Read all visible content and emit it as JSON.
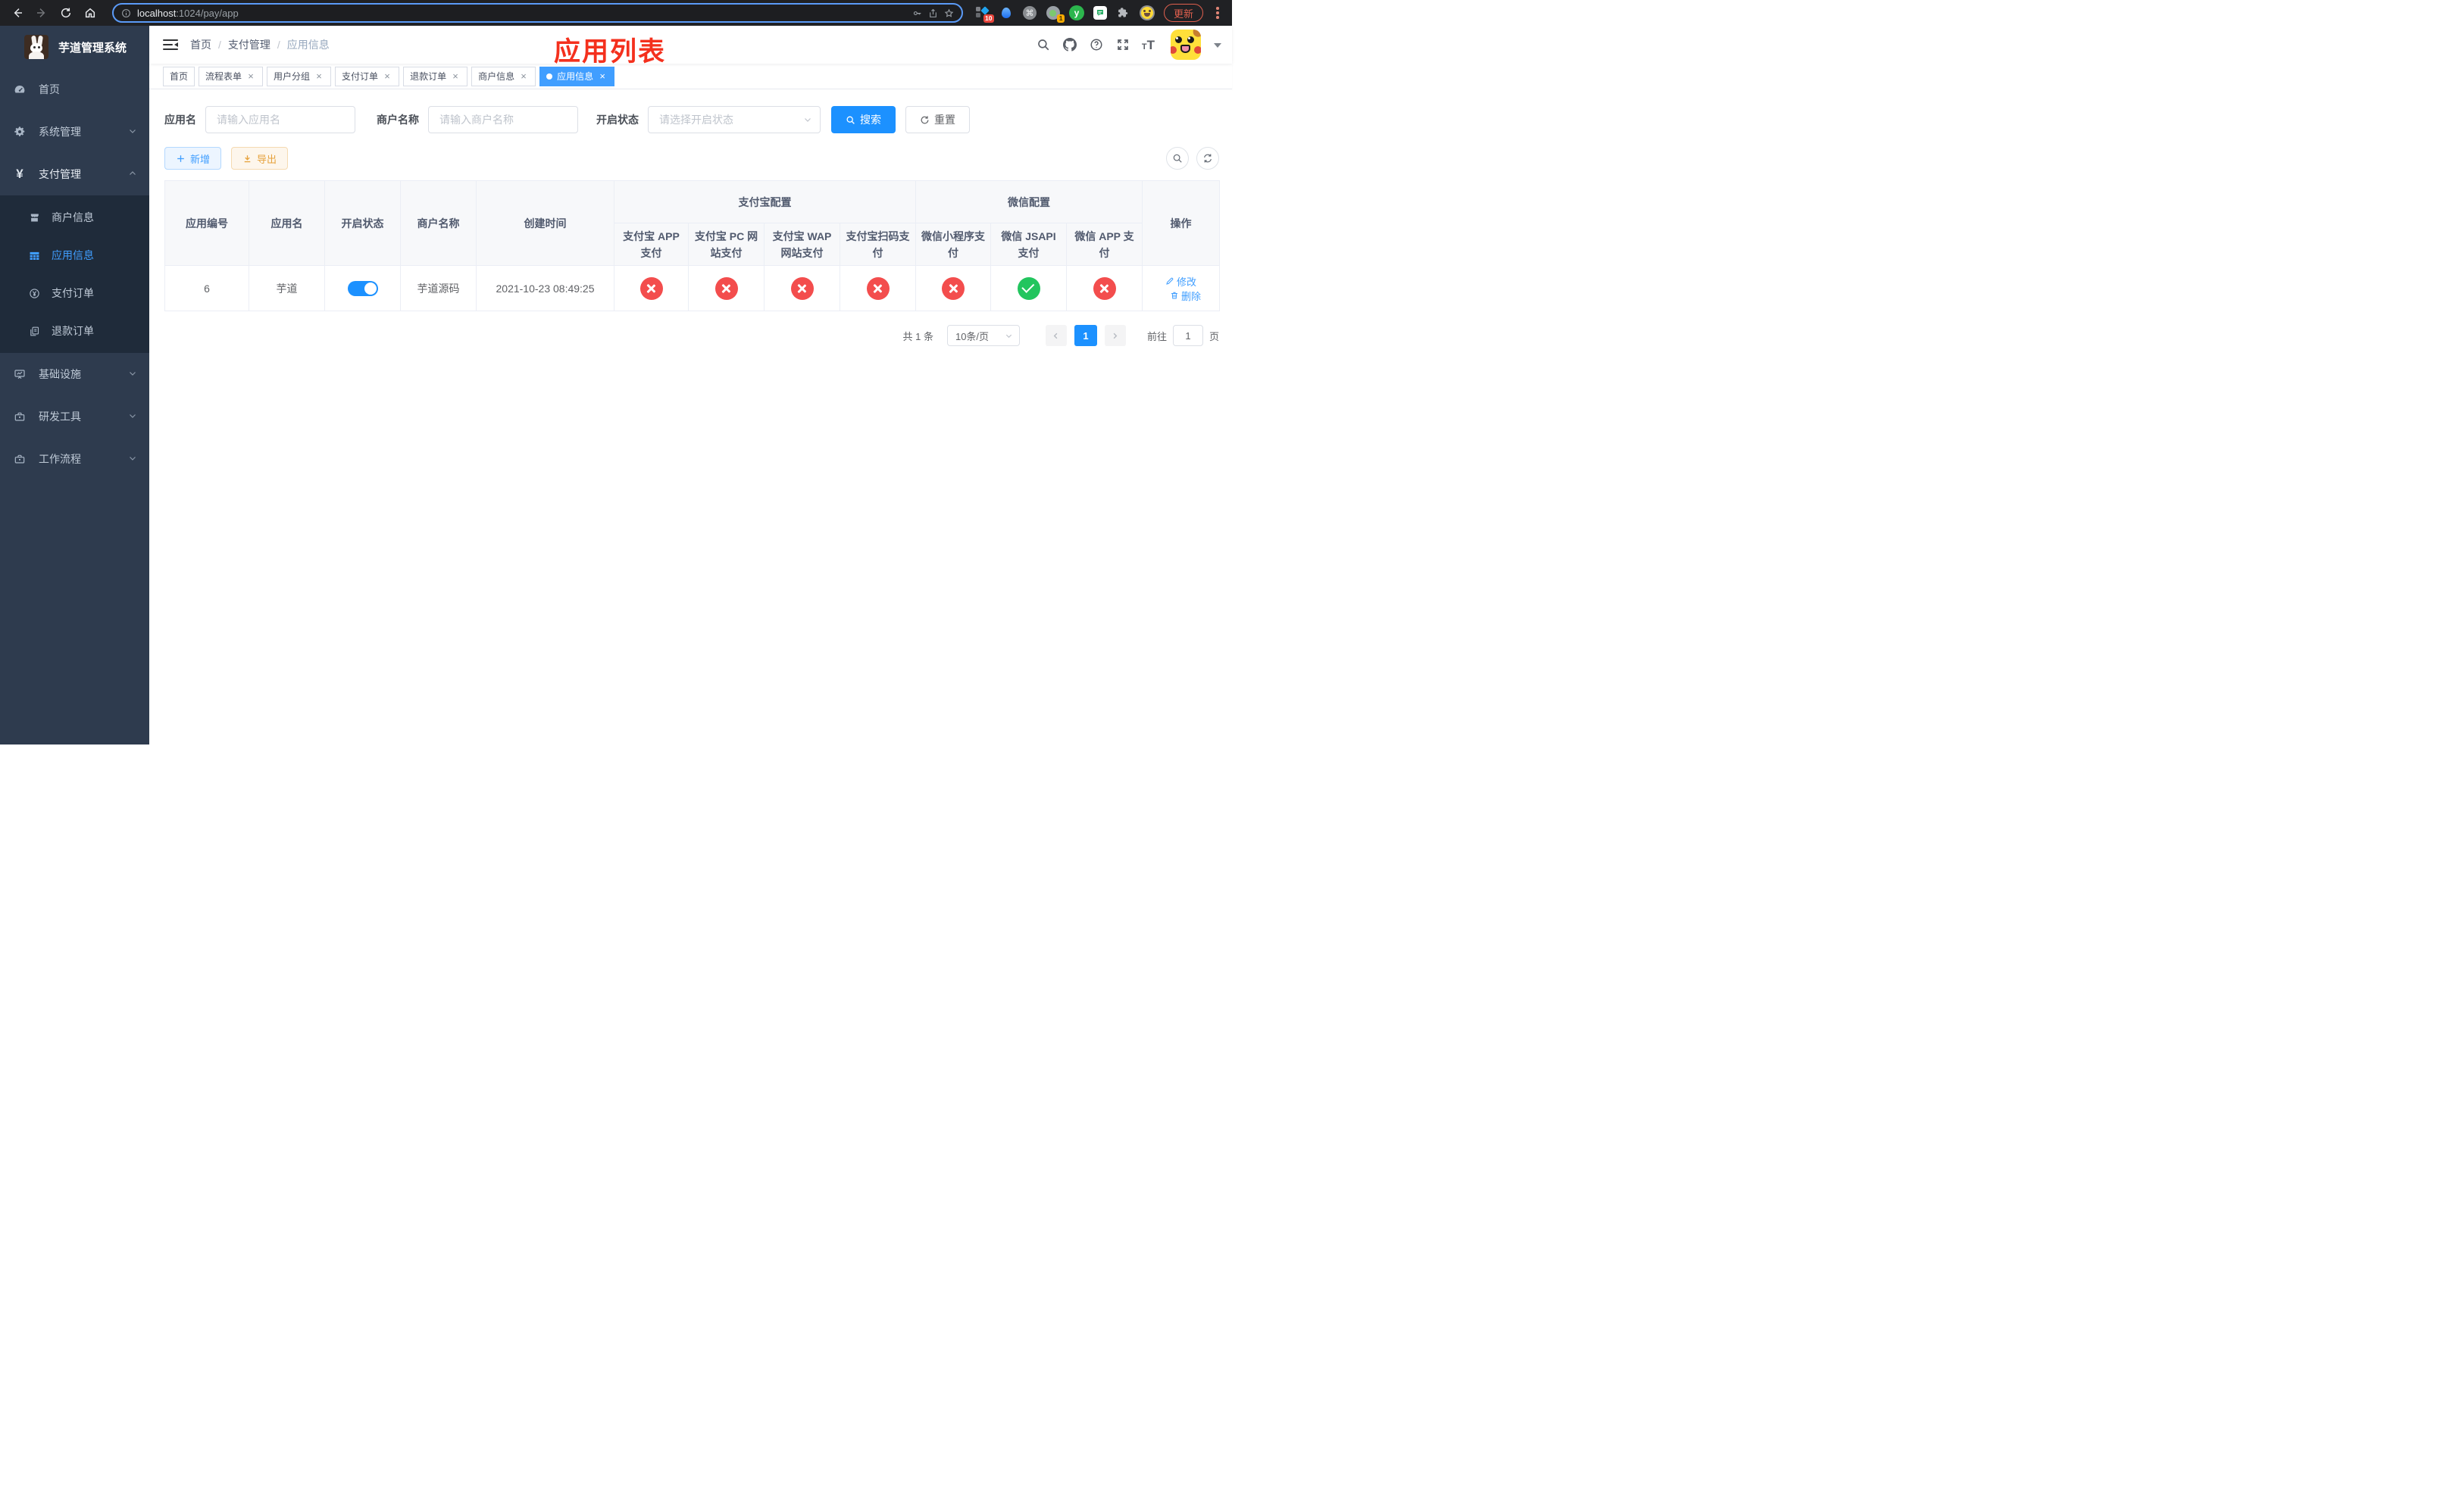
{
  "browser": {
    "url_host": "localhost",
    "url_rest": ":1024/pay/app",
    "update_label": "更新",
    "ext_badge_count": "10",
    "ext_profile_badge": "1",
    "ext_y_letter": "y",
    "ext_cmd_glyph": "⌘"
  },
  "colors": {
    "accent": "#409eff",
    "success": "#22c55e",
    "danger": "#f34d4d",
    "warning": "#e6a23c",
    "annotation": "#f4301d",
    "sidebar_bg": "#2e3b4e"
  },
  "sidebar": {
    "title": "芋道管理系统",
    "items": [
      {
        "label": "首页",
        "icon": "dashboard-icon"
      },
      {
        "label": "系统管理",
        "icon": "gear-icon"
      },
      {
        "label": "支付管理",
        "icon": "yen-icon"
      },
      {
        "label": "基础设施",
        "icon": "monitor-icon"
      },
      {
        "label": "研发工具",
        "icon": "toolbox-icon"
      },
      {
        "label": "工作流程",
        "icon": "toolbox-icon"
      }
    ],
    "pay_children": [
      {
        "label": "商户信息",
        "icon": "shop-icon"
      },
      {
        "label": "应用信息",
        "icon": "table-icon",
        "active": true
      },
      {
        "label": "支付订单",
        "icon": "yen-circle-icon"
      },
      {
        "label": "退款订单",
        "icon": "document-icon"
      }
    ]
  },
  "navbar": {
    "breadcrumb": [
      "首页",
      "支付管理",
      "应用信息"
    ],
    "annotation": "应用列表"
  },
  "tags": [
    {
      "label": "首页",
      "closable": false,
      "active": false
    },
    {
      "label": "流程表单",
      "closable": true,
      "active": false
    },
    {
      "label": "用户分组",
      "closable": true,
      "active": false
    },
    {
      "label": "支付订单",
      "closable": true,
      "active": false
    },
    {
      "label": "退款订单",
      "closable": true,
      "active": false
    },
    {
      "label": "商户信息",
      "closable": true,
      "active": false
    },
    {
      "label": "应用信息",
      "closable": true,
      "active": true
    }
  ],
  "filters": {
    "app_name_label": "应用名",
    "app_name_placeholder": "请输入应用名",
    "merchant_label": "商户名称",
    "merchant_placeholder": "请输入商户名称",
    "status_label": "开启状态",
    "status_placeholder": "请选择开启状态",
    "search_label": "搜索",
    "reset_label": "重置"
  },
  "toolbar": {
    "add_label": "新增",
    "export_label": "导出"
  },
  "table": {
    "groups": {
      "alipay": "支付宝配置",
      "wechat": "微信配置"
    },
    "columns": {
      "id": "应用编号",
      "name": "应用名",
      "status": "开启状态",
      "merchant": "商户名称",
      "created": "创建时间",
      "alipay_app": "支付宝 APP 支付",
      "alipay_pc": "支付宝 PC 网站支付",
      "alipay_wap": "支付宝 WAP 网站支付",
      "alipay_qr": "支付宝扫码支付",
      "wx_mini": "微信小程序支付",
      "wx_jsapi": "微信 JSAPI 支付",
      "wx_app": "微信 APP 支付",
      "actions": "操作"
    },
    "row": {
      "id": "6",
      "name": "芋道",
      "enabled": true,
      "merchant": "芋道源码",
      "created": "2021-10-23 08:49:25",
      "pay_states": [
        false,
        false,
        false,
        false,
        false,
        true,
        false
      ],
      "edit_label": "修改",
      "delete_label": "删除"
    }
  },
  "pagination": {
    "total": "共 1 条",
    "page_size": "10条/页",
    "current_page": "1",
    "goto_prefix": "前往",
    "goto_value": "1",
    "goto_suffix": "页"
  }
}
